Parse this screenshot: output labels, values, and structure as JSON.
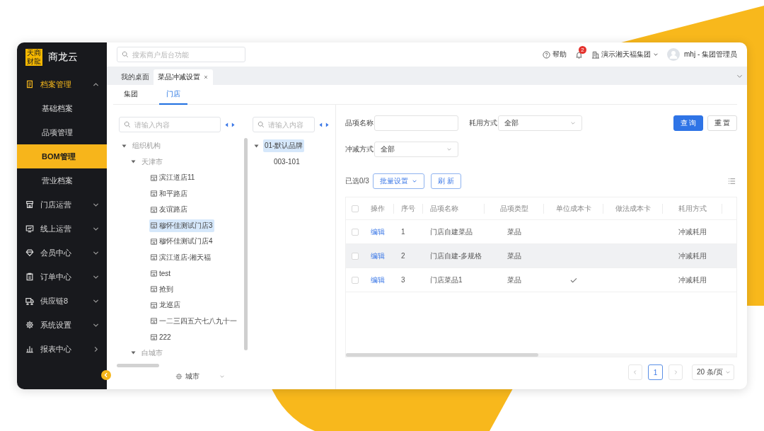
{
  "brand": {
    "logo": "天商财龍",
    "name": "商龙云"
  },
  "sidebar": {
    "items": [
      {
        "label": "档案管理",
        "kind": "group",
        "expanded": true,
        "active": true,
        "children": [
          {
            "label": "基础档案",
            "selected": false
          },
          {
            "label": "品项管理",
            "selected": false
          },
          {
            "label": "BOM管理",
            "selected": true
          },
          {
            "label": "营业档案",
            "selected": false
          }
        ]
      },
      {
        "label": "门店运营",
        "kind": "group",
        "expanded": false,
        "active": false
      },
      {
        "label": "线上运营",
        "kind": "group",
        "expanded": false,
        "active": false
      },
      {
        "label": "会员中心",
        "kind": "group",
        "expanded": false,
        "active": false
      },
      {
        "label": "订单中心",
        "kind": "group",
        "expanded": false,
        "active": false
      },
      {
        "label": "供应链8",
        "kind": "group",
        "expanded": false,
        "active": false
      },
      {
        "label": "系统设置",
        "kind": "group",
        "expanded": false,
        "active": false
      },
      {
        "label": "报表中心",
        "kind": "flyout",
        "active": false
      }
    ]
  },
  "topbar": {
    "search": {
      "placeholder": "搜索商户后台功能"
    },
    "help": "帮助",
    "notification_count": "2",
    "organization": "演示湘天福集团",
    "user": "mhj - 集团管理员"
  },
  "page_tabs": [
    {
      "label": "我的桌面",
      "selected": false,
      "closable": false
    },
    {
      "label": "菜品冲减设置",
      "selected": true,
      "closable": true
    }
  ],
  "sub_tabs": [
    {
      "label": "集团",
      "selected": false
    },
    {
      "label": "门店",
      "selected": true
    }
  ],
  "org_tree": {
    "search": {
      "placeholder": "请输入内容"
    },
    "nodes": [
      {
        "label": "组织机构",
        "kind": "group",
        "expanded": true,
        "selected": false,
        "children": [
          {
            "label": "天津市",
            "kind": "group",
            "expanded": true,
            "selected": false,
            "children": [
              {
                "label": "滨江道店11",
                "kind": "store",
                "selected": false
              },
              {
                "label": "和平路店",
                "kind": "store",
                "selected": false
              },
              {
                "label": "友谊路店",
                "kind": "store",
                "selected": false
              },
              {
                "label": "穆怀佳测试门店3",
                "kind": "store",
                "selected": true
              },
              {
                "label": "穆怀佳测试门店4",
                "kind": "store",
                "selected": false
              },
              {
                "label": "滨江道店-湘天福",
                "kind": "store",
                "selected": false
              },
              {
                "label": "test",
                "kind": "store",
                "selected": false
              },
              {
                "label": "抢到",
                "kind": "store",
                "selected": false
              },
              {
                "label": "龙巡店",
                "kind": "store",
                "selected": false
              },
              {
                "label": "一二三四五六七八九十一",
                "kind": "store",
                "selected": false
              },
              {
                "label": "222",
                "kind": "store",
                "selected": false
              }
            ]
          },
          {
            "label": "白城市",
            "kind": "group",
            "expanded": true,
            "selected": false
          }
        ]
      }
    ],
    "footer": "城市"
  },
  "brand_tree": {
    "search": {
      "placeholder": "请输入内容"
    },
    "nodes": [
      {
        "label": "01-默认品牌",
        "kind": "group",
        "expanded": true,
        "selected": true,
        "children": [
          {
            "label": "003-101",
            "kind": "item",
            "selected": false
          }
        ]
      }
    ]
  },
  "filters": [
    {
      "label": "品项名称",
      "kind": "text"
    },
    {
      "label": "耗用方式",
      "kind": "select",
      "value": "全部"
    },
    {
      "label": "冲减方式",
      "kind": "select",
      "value": "全部"
    }
  ],
  "filter_buttons": [
    {
      "label": "查 询",
      "kind": "primary"
    },
    {
      "label": "重 置",
      "kind": "default"
    }
  ],
  "toolbar": {
    "selection": "已选0/3",
    "buttons": [
      {
        "label": "批量设置",
        "dropdown": true
      },
      {
        "label": "刷 新",
        "dropdown": false
      }
    ]
  },
  "table": {
    "all_checked": false,
    "columns": [
      "操作",
      "序号",
      "品项名称",
      "品项类型",
      "单位成本卡",
      "做法成本卡",
      "耗用方式"
    ],
    "rows": [
      {
        "checked": false,
        "hovered": false,
        "action": "编辑",
        "index": "1",
        "name": "门店自建菜品",
        "type": "菜品",
        "unit_cost_card": false,
        "method_cost_card": false,
        "consumption": "冲减耗用"
      },
      {
        "checked": false,
        "hovered": true,
        "action": "编辑",
        "index": "2",
        "name": "门店自建-多规格",
        "type": "菜品",
        "unit_cost_card": false,
        "method_cost_card": false,
        "consumption": "冲减耗用"
      },
      {
        "checked": false,
        "hovered": false,
        "action": "编辑",
        "index": "3",
        "name": "门店菜品1",
        "type": "菜品",
        "unit_cost_card": true,
        "method_cost_card": false,
        "consumption": "冲减耗用"
      }
    ]
  },
  "pagination": {
    "pages": [
      {
        "label": "1",
        "selected": true
      }
    ],
    "page_size": "20 条/页"
  }
}
